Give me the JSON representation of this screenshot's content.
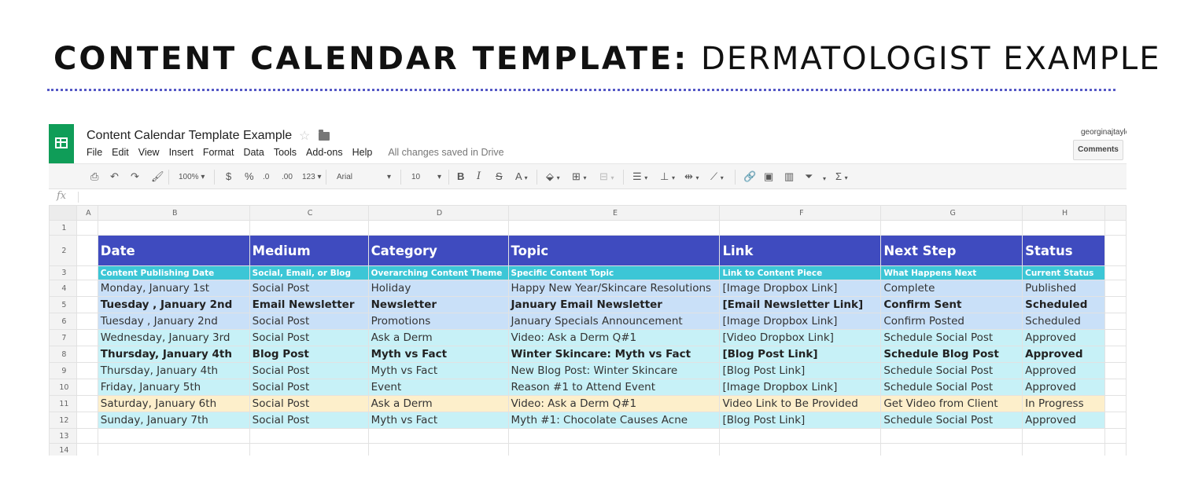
{
  "banner": {
    "title_bold": "CONTENT CALENDAR TEMPLATE:",
    "title_light": "DERMATOLOGIST EXAMPLE"
  },
  "app": {
    "doc_title": "Content Calendar Template Example",
    "menu": [
      "File",
      "Edit",
      "View",
      "Insert",
      "Format",
      "Data",
      "Tools",
      "Add-ons",
      "Help"
    ],
    "save_status": "All changes saved in Drive",
    "user_email": "georginajtaylor",
    "comments_label": "Comments",
    "toolbar": {
      "zoom": "100%",
      "currency": "$",
      "percent": "%",
      "decrease_decimal": ".0",
      "increase_decimal": ".00",
      "more_formats": "123",
      "font_family": "Arial",
      "font_size": "10",
      "bold": "B",
      "italic": "I",
      "strike": "S",
      "text_color": "A",
      "sum": "Σ"
    },
    "fx": "fx"
  },
  "sheet": {
    "columns": [
      "A",
      "B",
      "C",
      "D",
      "E",
      "F",
      "G",
      "H"
    ],
    "row_numbers": [
      "1",
      "2",
      "3",
      "4",
      "5",
      "6",
      "7",
      "8",
      "9",
      "10",
      "11",
      "12",
      "13",
      "14"
    ],
    "headers": [
      "Date",
      "Medium",
      "Category",
      "Topic",
      "Link",
      "Next Step",
      "Status"
    ],
    "subheaders": [
      "Content Publishing Date",
      "Social, Email, or Blog",
      "Overarching Content Theme",
      "Specific Content Topic",
      "Link to Content Piece",
      "What Happens Next",
      "Current Status"
    ],
    "rows": [
      {
        "bold": false,
        "color": "#c9e0f8",
        "cells": [
          "Monday, January 1st",
          "Social Post",
          "Holiday",
          "Happy New Year/Skincare Resolutions",
          "[Image Dropbox Link]",
          "Complete",
          "Published"
        ]
      },
      {
        "bold": true,
        "color": "#c9e0f8",
        "cells": [
          "Tuesday , January 2nd",
          "Email Newsletter",
          "Newsletter",
          "January Email Newsletter",
          "[Email Newsletter Link]",
          "Confirm Sent",
          "Scheduled"
        ]
      },
      {
        "bold": false,
        "color": "#c9e0f8",
        "cells": [
          "Tuesday , January 2nd",
          "Social Post",
          "Promotions",
          "January Specials Announcement",
          "[Image Dropbox Link]",
          "Confirm Posted",
          "Scheduled"
        ]
      },
      {
        "bold": false,
        "color": "#c7f1f7",
        "cells": [
          "Wednesday, January 3rd",
          "Social Post",
          "Ask a Derm",
          "Video: Ask a Derm Q#1",
          "[Video Dropbox Link]",
          "Schedule Social Post",
          "Approved"
        ]
      },
      {
        "bold": true,
        "color": "#c7f1f7",
        "cells": [
          "Thursday, January 4th",
          "Blog Post",
          "Myth vs Fact",
          "Winter Skincare: Myth vs Fact",
          "[Blog Post Link]",
          "Schedule Blog Post",
          "Approved"
        ]
      },
      {
        "bold": false,
        "color": "#c7f1f7",
        "cells": [
          "Thursday, January 4th",
          "Social Post",
          "Myth vs Fact",
          "New Blog Post: Winter Skincare",
          "[Blog Post Link]",
          "Schedule Social Post",
          "Approved"
        ]
      },
      {
        "bold": false,
        "color": "#c7f1f7",
        "cells": [
          "Friday, January 5th",
          "Social Post",
          "Event",
          "Reason #1 to Attend Event",
          "[Image Dropbox Link]",
          "Schedule Social Post",
          "Approved"
        ]
      },
      {
        "bold": false,
        "color": "#fdefcb",
        "cells": [
          "Saturday, January 6th",
          "Social Post",
          "Ask a Derm",
          "Video: Ask a Derm Q#1",
          "Video Link to Be Provided",
          "Get Video from Client",
          "In Progress"
        ]
      },
      {
        "bold": false,
        "color": "#c7f1f7",
        "cells": [
          "Sunday, January 7th",
          "Social Post",
          "Myth vs Fact",
          "Myth #1: Chocolate Causes Acne",
          "[Blog Post Link]",
          "Schedule Social Post",
          "Approved"
        ]
      }
    ]
  },
  "colors": {
    "header_bg": "#3f4bbf",
    "subheader_bg": "#3cc6d6",
    "sheets_green": "#0f9d58",
    "dotted_rule": "#5458c6"
  }
}
